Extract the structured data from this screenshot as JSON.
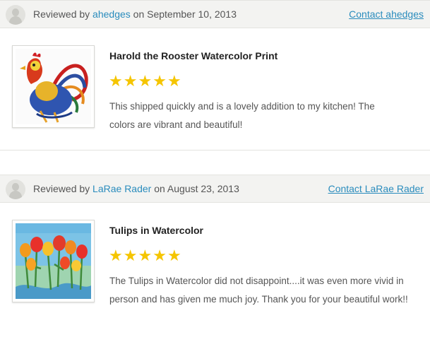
{
  "reviews": [
    {
      "prefix": "Reviewed by",
      "reviewer": "ahedges",
      "date_text": "on September 10, 2013",
      "contact_label": "Contact ahedges",
      "product_title": "Harold the Rooster Watercolor Print",
      "rating": 5,
      "rating_max": 5,
      "text": "This shipped quickly and is a lovely addition to my kitchen! The colors are vibrant and beautiful!"
    },
    {
      "prefix": "Reviewed by",
      "reviewer": "LaRae Rader",
      "date_text": "on August 23, 2013",
      "contact_label": "Contact LaRae Rader",
      "product_title": "Tulips in Watercolor",
      "rating": 5,
      "rating_max": 5,
      "text": "The Tulips in Watercolor did not disappoint....it was even more vivid in person and has given me much joy. Thank you for your beautiful work!!"
    }
  ],
  "colors": {
    "link": "#2a8cbd",
    "star": "#f5c500",
    "header_bg": "#f3f3f1"
  },
  "icons": {
    "avatar": "user-avatar-icon",
    "star": "star-icon"
  }
}
